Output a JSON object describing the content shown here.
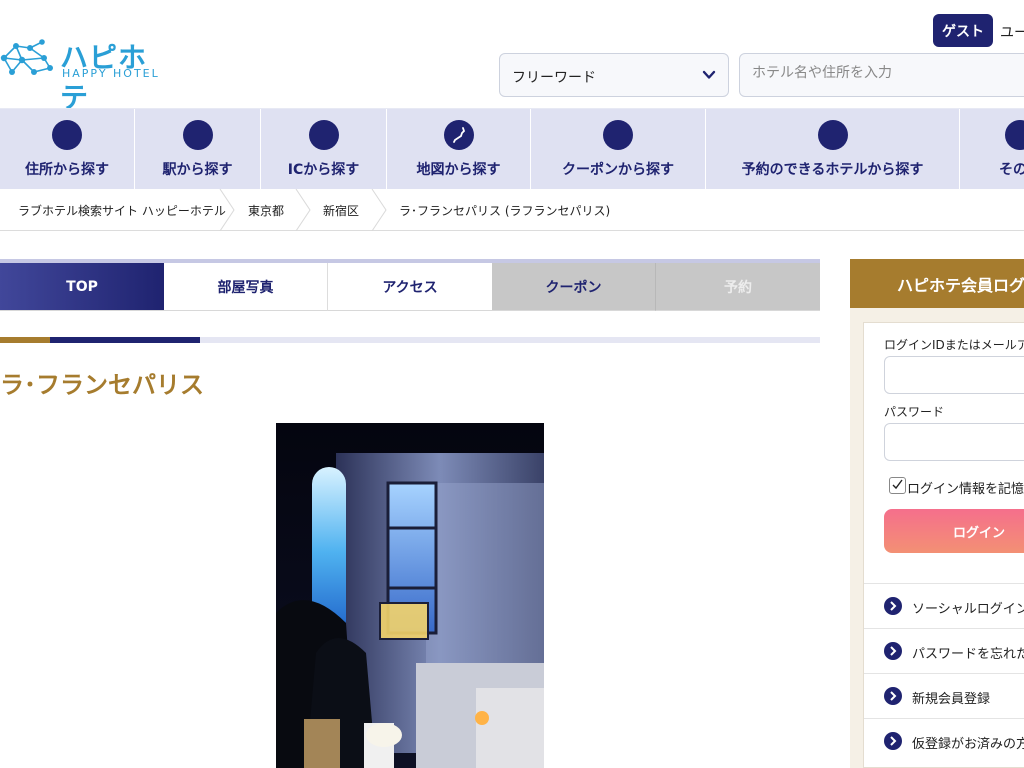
{
  "header": {
    "logo_text": "ハピホテ",
    "logo_subtext": "HAPPY HOTEL",
    "guest_badge": "ゲスト",
    "user_label": "ユー",
    "search_select_value": "フリーワード",
    "search_placeholder": "ホテル名や住所を入力"
  },
  "nav": {
    "items": [
      {
        "label": "住所から探す",
        "icon": "address-icon"
      },
      {
        "label": "駅から探す",
        "icon": "station-icon"
      },
      {
        "label": "ICから探す",
        "icon": "ic-icon"
      },
      {
        "label": "地図から探す",
        "icon": "map-icon"
      },
      {
        "label": "クーポンから探す",
        "icon": "coupon-icon"
      },
      {
        "label": "予約のできるホテルから探す",
        "icon": "reservation-icon"
      },
      {
        "label": "その他",
        "icon": "more-icon"
      }
    ]
  },
  "breadcrumb": {
    "items": [
      "ラブホテル検索サイト ハッピーホテル",
      "東京都",
      "新宿区",
      "ラ･フランセパリス (ラフランセパリス)"
    ]
  },
  "tabs": {
    "items": [
      {
        "label": "TOP",
        "state": "active"
      },
      {
        "label": "部屋写真",
        "state": "enabled"
      },
      {
        "label": "アクセス",
        "state": "enabled"
      },
      {
        "label": "クーポン",
        "state": "gray"
      },
      {
        "label": "予約",
        "state": "disabled"
      }
    ]
  },
  "hotel": {
    "name": "ラ･フランセパリス"
  },
  "login": {
    "title": "ハピホテ会員ログ",
    "id_label": "ログインIDまたはメールアドレ",
    "password_label": "パスワード",
    "remember_label": "ログイン情報を記憶す",
    "remember_checked": true,
    "button_label": "ログイン",
    "links": [
      {
        "label": "ソーシャルログイン"
      },
      {
        "label": "パスワードを忘れた方"
      },
      {
        "label": "新規会員登録"
      },
      {
        "label": "仮登録がお済みの方"
      }
    ]
  },
  "colors": {
    "brand_navy": "#1f2370",
    "brand_gold": "#a67c2e",
    "logo_blue": "#2a9fd6",
    "nav_bg": "#dfe1f2",
    "login_button": "#f56f8c"
  }
}
